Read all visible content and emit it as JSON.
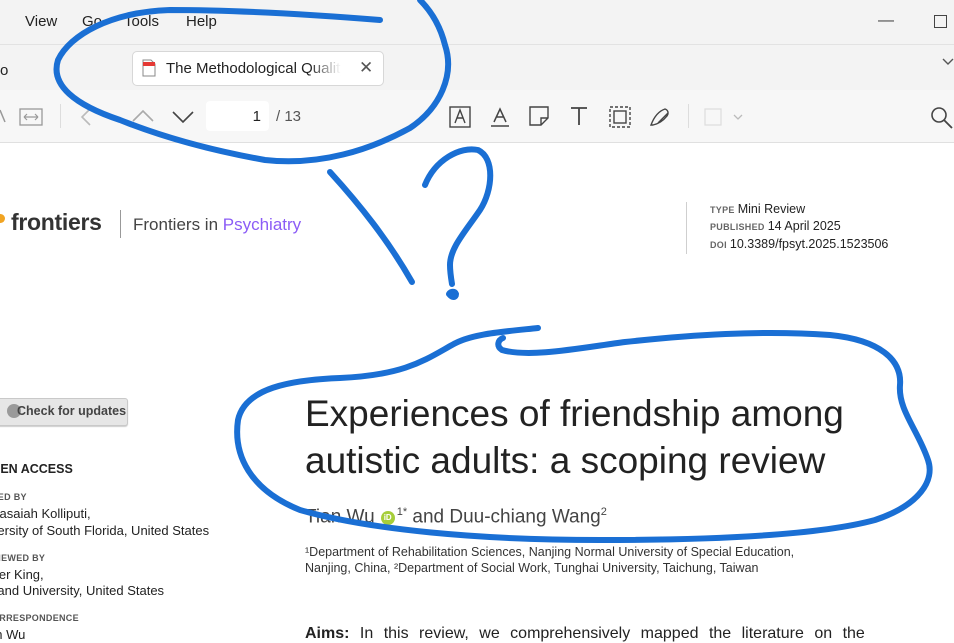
{
  "menubar": {
    "items": [
      "View",
      "Go",
      "Tools",
      "Help"
    ]
  },
  "tabbar": {
    "left_label": "o",
    "active_tab": {
      "title": "The Methodological Quality of Scoping Reviews"
    }
  },
  "toolbar": {
    "page_current": "1",
    "page_total": "/ 13"
  },
  "document": {
    "logo_word": "frontiers",
    "journal_prefix": "Frontiers in ",
    "journal_accent": "Psychiatry",
    "meta": {
      "type_key": "TYPE",
      "type_value": "Mini Review",
      "published_key": "PUBLISHED",
      "published_value": "14 April 2025",
      "doi_key": "DOI",
      "doi_value": "10.3389/fpsyt.2025.1523506"
    },
    "check_updates": "Check for updates",
    "open_access": "PEN ACCESS",
    "edited_by_key": "TED BY",
    "edited_by_name": "arasaiah Kolliputi,",
    "edited_by_affil": "iversity of South Florida, United States",
    "reviewed_by_key": "VIEWED BY",
    "reviewed_by_name": "nter King,",
    "reviewed_by_affil": "kland University, United States",
    "correspondence_key": "ORRESPONDENCE",
    "correspondence_name": "an Wu",
    "title_line1": "Experiences of friendship among",
    "title_line2": "autistic adults: a scoping review",
    "author1": "Tian Wu",
    "author1_sup": "1*",
    "author_joiner": " and Duu-chiang Wang",
    "author2_sup": "2",
    "orcid_label": "iD",
    "affiliation_line1": "¹Department of Rehabilitation Sciences, Nanjing Normal University of Special Education,",
    "affiliation_line2": "Nanjing, China, ²Department of Social Work, Tunghai University, Taichung, Taiwan",
    "abstract_label": "Aims:",
    "abstract_text": " In this review, we comprehensively mapped the literature on the"
  },
  "annotation": {
    "color": "#1a6fd4",
    "mark": "?"
  },
  "colors": {
    "accent": "#8b5cf6",
    "logo_orange": "#f1a422",
    "orcid_green": "#a6ce39"
  }
}
